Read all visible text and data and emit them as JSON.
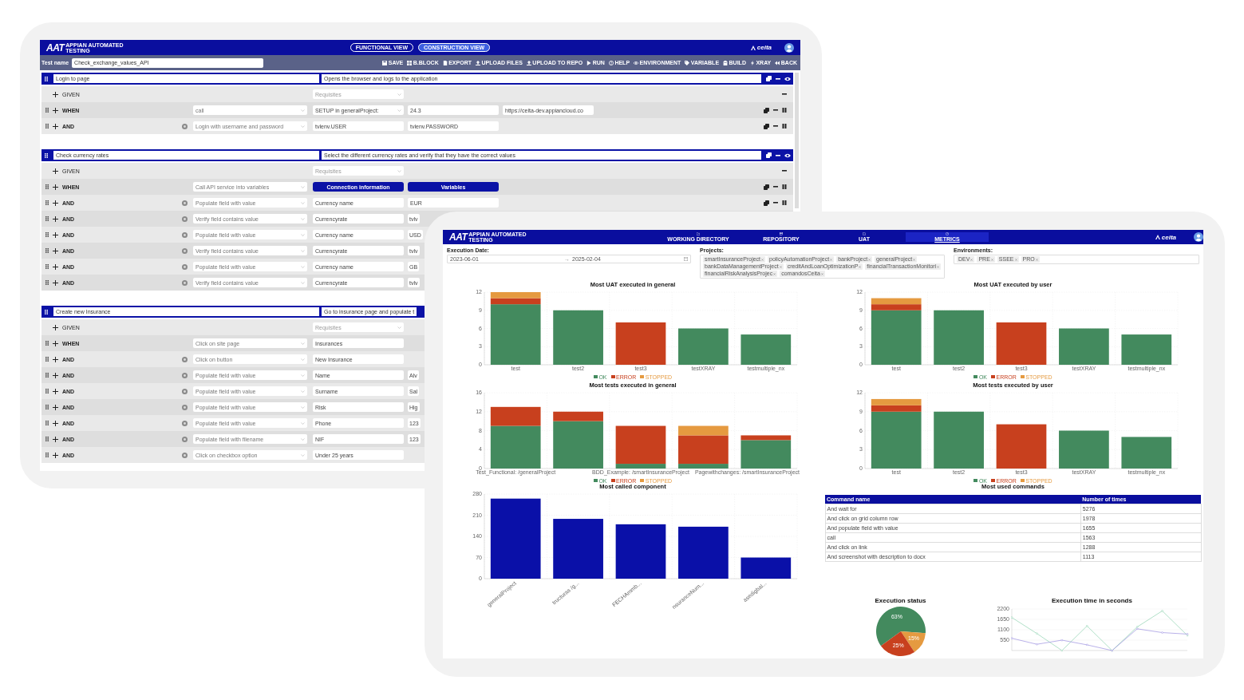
{
  "editor": {
    "logo": {
      "mark": "AAT",
      "tagline": "APPIAN AUTOMATED TESTING"
    },
    "views": [
      {
        "label": "FUNCTIONAL VIEW",
        "selected": false
      },
      {
        "label": "CONSTRUCTION VIEW",
        "selected": true
      }
    ],
    "brand": "ceita",
    "test_name": {
      "label": "Test name",
      "value": "Check_exchange_values_API"
    },
    "actions": [
      "SAVE",
      "B.BLOCK",
      "EXPORT",
      "UPLOAD FILES",
      "UPLOAD TO REPO",
      "RUN",
      "HELP",
      "ENVIRONMENT",
      "VARIABLE",
      "BUILD",
      "XRAY",
      "BACK"
    ],
    "blocks": [
      {
        "title": "Login to page",
        "description": "Opens the browser and logs to the application",
        "tools": true,
        "rows": [
          {
            "kind": "given",
            "keyword": "GIVEN",
            "fields": [
              {
                "kind": "select",
                "placeholder": "Requisites"
              }
            ],
            "tools": true
          },
          {
            "kind": "when",
            "keyword": "WHEN",
            "command": "call",
            "fields": [
              {
                "kind": "select",
                "value": "SETUP in generalProject:"
              },
              {
                "kind": "input",
                "value": "24.3"
              },
              {
                "kind": "input",
                "value": "https://ceita-dev.appiancloud.co"
              }
            ],
            "tools": true
          },
          {
            "kind": "and",
            "keyword": "AND",
            "command": "Login with username and password",
            "fields": [
              {
                "kind": "input",
                "value": "tvlenv.USER"
              },
              {
                "kind": "input",
                "value": "tvlenv.PASSWORD"
              }
            ],
            "tools": true
          }
        ]
      },
      {
        "title": "Check currency rates",
        "description": "Select the different currency rates and verify that they have the correct values",
        "tools": true,
        "rows": [
          {
            "kind": "given",
            "keyword": "GIVEN",
            "fields": [
              {
                "kind": "select",
                "placeholder": "Requisites"
              }
            ],
            "tools": true
          },
          {
            "kind": "when",
            "keyword": "WHEN",
            "command": "Call API service into variables",
            "fields": [
              {
                "kind": "button",
                "label": "Connection information"
              },
              {
                "kind": "button",
                "label": "Variables"
              }
            ],
            "tools": true
          },
          {
            "kind": "and",
            "keyword": "AND",
            "command": "Populate field with value",
            "fields": [
              {
                "kind": "input",
                "value": "Currency name"
              },
              {
                "kind": "input",
                "value": "EUR"
              }
            ],
            "tools": true
          },
          {
            "kind": "and",
            "keyword": "AND",
            "command": "Verify field contains value",
            "fields": [
              {
                "kind": "input",
                "value": "Currencyrate"
              },
              {
                "kind": "input",
                "value": "tvlv"
              }
            ],
            "tools": false
          },
          {
            "kind": "and",
            "keyword": "AND",
            "command": "Populate field with value",
            "fields": [
              {
                "kind": "input",
                "value": "Currency name"
              },
              {
                "kind": "input",
                "value": "USD"
              }
            ],
            "tools": false
          },
          {
            "kind": "and",
            "keyword": "AND",
            "command": "Verify field contains value",
            "fields": [
              {
                "kind": "input",
                "value": "Currencyrate"
              },
              {
                "kind": "input",
                "value": "tvlv"
              }
            ],
            "tools": false
          },
          {
            "kind": "and",
            "keyword": "AND",
            "command": "Populate field with value",
            "fields": [
              {
                "kind": "input",
                "value": "Currency name"
              },
              {
                "kind": "input",
                "value": "GB"
              }
            ],
            "tools": false
          },
          {
            "kind": "and",
            "keyword": "AND",
            "command": "Verify field contains value",
            "fields": [
              {
                "kind": "input",
                "value": "Currencyrate"
              },
              {
                "kind": "input",
                "value": "tvlv"
              }
            ],
            "tools": false
          }
        ]
      },
      {
        "title": "Create new Insurance",
        "description": "Go to insurance page and populate t",
        "tools": false,
        "rows": [
          {
            "kind": "given",
            "keyword": "GIVEN",
            "fields": [
              {
                "kind": "select",
                "placeholder": "Requisites"
              }
            ]
          },
          {
            "kind": "when",
            "keyword": "WHEN",
            "command": "Click on site page",
            "fields": [
              {
                "kind": "input",
                "value": "Insurances"
              }
            ]
          },
          {
            "kind": "and",
            "keyword": "AND",
            "command": "Click on button",
            "fields": [
              {
                "kind": "input",
                "value": "New Insurance"
              }
            ]
          },
          {
            "kind": "and",
            "keyword": "AND",
            "command": "Populate field with value",
            "fields": [
              {
                "kind": "input",
                "value": "Name"
              },
              {
                "kind": "input",
                "value": "Alv"
              }
            ],
            "tools": false
          },
          {
            "kind": "and",
            "keyword": "AND",
            "command": "Populate field with value",
            "fields": [
              {
                "kind": "input",
                "value": "Surname"
              },
              {
                "kind": "input",
                "value": "Sal"
              }
            ],
            "tools": false
          },
          {
            "kind": "and",
            "keyword": "AND",
            "command": "Populate field with value",
            "fields": [
              {
                "kind": "input",
                "value": "Risk"
              },
              {
                "kind": "input",
                "value": "Hig"
              }
            ],
            "tools": false
          },
          {
            "kind": "and",
            "keyword": "AND",
            "command": "Populate field with value",
            "fields": [
              {
                "kind": "input",
                "value": "Phone"
              },
              {
                "kind": "input",
                "value": "123"
              }
            ],
            "tools": false
          },
          {
            "kind": "and",
            "keyword": "AND",
            "command": "Populate field with filename",
            "fields": [
              {
                "kind": "input",
                "value": "NIF"
              },
              {
                "kind": "input",
                "value": "123"
              }
            ],
            "tools": false
          },
          {
            "kind": "and",
            "keyword": "AND",
            "command": "Click on checkbox option",
            "fields": [
              {
                "kind": "input",
                "value": "Under 25 years"
              }
            ]
          }
        ]
      }
    ]
  },
  "dashboard": {
    "logo": {
      "mark": "AAT",
      "tagline": "APPIAN AUTOMATED TESTING"
    },
    "nav": [
      {
        "label": "WORKING DIRECTORY",
        "selected": false
      },
      {
        "label": "REPOSITORY",
        "selected": false
      },
      {
        "label": "UAT",
        "selected": false
      },
      {
        "label": "METRICS",
        "selected": true
      }
    ],
    "brand": "ceita",
    "filters": {
      "date": {
        "label": "Execution Date:",
        "from": "2023-06-01",
        "separator": "→",
        "to": "2025-02-04"
      },
      "projects": {
        "label": "Projects:",
        "tags": [
          "smartInsuranceProject",
          "policyAutomationProject",
          "bankProject",
          "generalProject",
          "bankDataManagementProject",
          "creditAndLoanOptimizationP",
          "financialTransactionMonitori",
          "financialRiskAnalysisProjec",
          "comandosCeita"
        ]
      },
      "environments": {
        "label": "Environments:",
        "tags": [
          "DEV",
          "PRE",
          "SSEE",
          "PRO"
        ]
      }
    },
    "charts": [
      {
        "chart_data": {
          "type": "bar",
          "title": "Most UAT executed in general",
          "stacked": true,
          "grid": true,
          "legend": "bottom",
          "categories": [
            "test",
            "test2",
            "test3",
            "testXRAY",
            "testmultiple_nx"
          ],
          "ylim": [
            0,
            12
          ],
          "yticks": [
            0,
            3,
            6,
            9,
            12
          ],
          "series": [
            {
              "name": "OK",
              "color": "#438a5e",
              "values": [
                10,
                9,
                0,
                6,
                5
              ]
            },
            {
              "name": "ERROR",
              "color": "#c8401e",
              "values": [
                1,
                0,
                7,
                0,
                0
              ]
            },
            {
              "name": "STOPPED",
              "color": "#e59a40",
              "values": [
                1,
                0,
                0,
                0,
                0
              ]
            }
          ]
        }
      },
      {
        "chart_data": {
          "type": "bar",
          "title": "Most UAT executed by user",
          "stacked": true,
          "grid": true,
          "legend": "bottom",
          "categories": [
            "test",
            "test2",
            "test3",
            "testXRAY",
            "testmultiple_nx"
          ],
          "ylim": [
            0,
            12
          ],
          "yticks": [
            0,
            3,
            6,
            9,
            12
          ],
          "series": [
            {
              "name": "OK",
              "color": "#438a5e",
              "values": [
                9,
                9,
                0,
                6,
                5
              ]
            },
            {
              "name": "ERROR",
              "color": "#c8401e",
              "values": [
                1,
                0,
                7,
                0,
                0
              ]
            },
            {
              "name": "STOPPED",
              "color": "#e59a40",
              "values": [
                1,
                0,
                0,
                0,
                0
              ]
            }
          ]
        }
      },
      {
        "chart_data": {
          "type": "bar",
          "title": "Most tests executed in general",
          "stacked": true,
          "grid": true,
          "legend": "bottom",
          "categories": [
            "Test_Functional: /generalProject",
            null,
            "BDD_Example: /smartInsuranceProject",
            null,
            "Pagewithchanges: /smartInsuranceProject"
          ],
          "ylim": [
            0,
            16
          ],
          "yticks": [
            0,
            4,
            8,
            12,
            16
          ],
          "series": [
            {
              "name": "OK",
              "color": "#438a5e",
              "values": [
                9,
                10,
                1,
                1,
                6
              ]
            },
            {
              "name": "ERROR",
              "color": "#c8401e",
              "values": [
                4,
                2,
                8,
                6,
                1
              ]
            },
            {
              "name": "STOPPED",
              "color": "#e59a40",
              "values": [
                0,
                0,
                0,
                2,
                0
              ]
            }
          ]
        }
      },
      {
        "chart_data": {
          "type": "bar",
          "title": "Most tests executed by user",
          "stacked": true,
          "grid": true,
          "legend": "bottom",
          "categories": [
            "test",
            "test2",
            "test3",
            "testXRAY",
            "testmultiple_nx"
          ],
          "ylim": [
            0,
            12
          ],
          "yticks": [
            0,
            3,
            6,
            9,
            12
          ],
          "series": [
            {
              "name": "OK",
              "color": "#438a5e",
              "values": [
                9,
                9,
                0,
                6,
                5
              ]
            },
            {
              "name": "ERROR",
              "color": "#c8401e",
              "values": [
                1,
                0,
                7,
                0,
                0
              ]
            },
            {
              "name": "STOPPED",
              "color": "#e59a40",
              "values": [
                1,
                0,
                0,
                0,
                0
              ]
            }
          ]
        }
      },
      {
        "chart_data": {
          "type": "bar",
          "title": "Most called component",
          "grid": true,
          "categories": [
            "generalProject",
            "tructuras /g...",
            "FECHAmmb...",
            "nsuranceNum...",
            "asedigbal..."
          ],
          "ylim": [
            0,
            280
          ],
          "yticks": [
            0,
            70,
            140,
            210,
            280
          ],
          "series": [
            {
              "color": "#0a10a8",
              "values": [
                265,
                198,
                180,
                172,
                70
              ]
            }
          ]
        }
      }
    ],
    "commands": {
      "title": "Most used commands",
      "columns": [
        "Command name",
        "Number of times"
      ],
      "rows": [
        [
          "And wait for",
          "5276"
        ],
        [
          "And click on grid column row",
          "1978"
        ],
        [
          "And populate field with value",
          "1655"
        ],
        [
          "call",
          "1563"
        ],
        [
          "And click on link",
          "1288"
        ],
        [
          "And screenshot with description to docx",
          "1113"
        ]
      ]
    },
    "status": {
      "chart_data": {
        "type": "pie",
        "title": "Execution status",
        "values": [
          63,
          15,
          25
        ],
        "colors": [
          "#438a5e",
          "#e59a40",
          "#c8401e"
        ],
        "value_labels": [
          "63%",
          "15%",
          "25%"
        ]
      }
    },
    "times": {
      "chart_data": {
        "type": "line",
        "title": "Execution time in seconds",
        "ylim": [
          0,
          2200
        ],
        "yticks": [
          550,
          1100,
          1650,
          2200
        ],
        "series": [
          {
            "color": "#8fd3b0",
            "values": [
              1750,
              900,
              0,
              1300,
              0,
              1250,
              2100,
              800
            ]
          },
          {
            "color": "#9b8fe0",
            "values": [
              650,
              330,
              550,
              300,
              0,
              1150,
              950,
              870
            ]
          }
        ]
      }
    }
  }
}
